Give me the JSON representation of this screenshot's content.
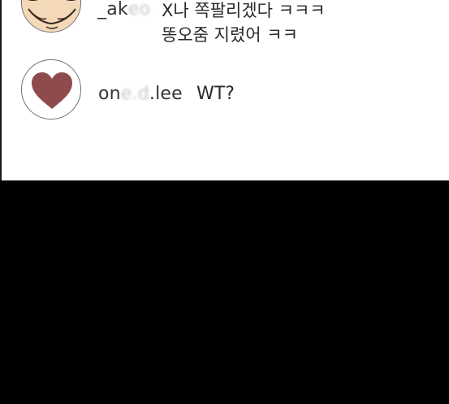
{
  "comments": [
    {
      "username_start": "_ak",
      "username_hidden": "eo",
      "username_end": "",
      "message_lines": [
        "X나 쪽팔리겠다 ㅋㅋㅋ",
        "똥오줌 지렸어 ㅋㅋ"
      ],
      "avatar_icon": "cartoon-face-avatar"
    },
    {
      "username_start": "on",
      "username_hidden": "e.d",
      "username_end": ".lee",
      "message_lines": [
        "WT?"
      ],
      "avatar_icon": "heart-icon"
    }
  ],
  "colors": {
    "panel_bg": "#ffffff",
    "page_bg": "#000000",
    "heart": "#8e4a4c",
    "text": "#2a2a2a"
  }
}
